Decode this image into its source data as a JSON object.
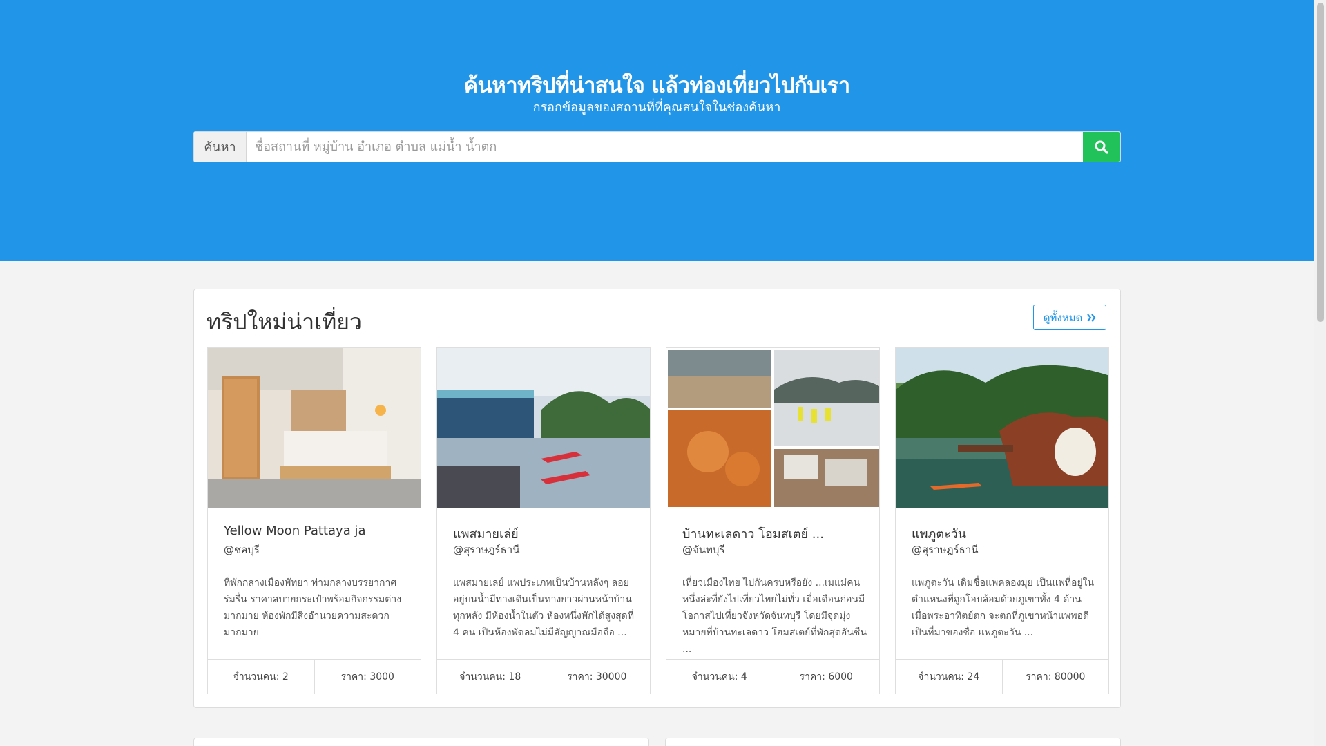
{
  "hero": {
    "title": "ค้นหาทริปที่น่าสนใจ แล้วท่องเที่ยวไปกับเรา",
    "subtitle": "กรอกข้อมูลของสถานที่ที่คุณสนใจในช่องค้นหา"
  },
  "search": {
    "addon_label": "ค้นหา",
    "placeholder": "ชื่อสถานที่ หมู่บ้าน อำเภอ ตำบล แม่น้ำ น้ำตก",
    "value": "",
    "button_icon": "search-icon"
  },
  "section": {
    "title": "ทริปใหม่น่าเที่ยว",
    "see_all_label": "ดูทั้งหมด",
    "see_all_icon": "double-chevron-right-icon"
  },
  "cards": [
    {
      "title": "Yellow Moon Pattaya ja",
      "location": "@ชลบุรี",
      "description": "ที่พักกลางเมืองพัทยา ท่ามกลางบรรยากาศร่มรื่น ราคาสบายกระเป๋าพร้อมกิจกรรมต่างมากมาย ห้องพักมีสิ่งอำนวยความสะดวกมากมาย",
      "people": "จำนวนคน: 2",
      "price": "ราคา: 3000"
    },
    {
      "title": "แพสมายเล่ย์",
      "location": "@สุราษฎร์ธานี",
      "description": "แพสมายเลย์ แพประเภทเป็นบ้านหลังๆ ลอยอยู่บนน้ำมีทางเดินเป็นทางยาวผ่านหน้าบ้านทุกหลัง มีห้องน้ำในตัว ห้องหนึ่งพักได้สูงสุดที่ 4 คน เป็นห้องพัดลมไม่มีสัญญาณมือถือ ...",
      "people": "จำนวนคน: 18",
      "price": "ราคา: 30000"
    },
    {
      "title": "บ้านทะเลดาว โฮมสเตย์ ...",
      "location": "@จันทบุรี",
      "description": "เที่ยวเมืองไทย ไปกันครบหรือยัง ...เมแม่คนหนึ่งล่ะที่ยังไปเที่ยวไทยไม่ทั่ว เมื่อเดือนก่อนมีโอกาสไปเที่ยวจังหวัดจันทบุรี โดยมีจุดมุ่งหมายที่บ้านทะเลดาว โฮมสเตย์ที่พักสุดอันชีน ...",
      "people": "จำนวนคน: 4",
      "price": "ราคา: 6000"
    },
    {
      "title": "แพภูตะวัน",
      "location": "@สุราษฎร์ธานี",
      "description": "แพภูตะวัน เดิมชื่อแพคลองมุย เป็นแพที่อยู่ในตำแหน่งที่ถูกโอบล้อมด้วยภูเขาทั้ง 4 ด้าน เมื่อพระอาทิตย์ตก จะตกที่ภูเขาหน้าแพพอดีเป็นที่มาของชื่อ แพภูตะวัน ...",
      "people": "จำนวนคน: 24",
      "price": "ราคา: 80000"
    }
  ],
  "colors": {
    "hero_bg": "#2196e8",
    "search_button": "#21c25a",
    "accent": "#2196e8"
  }
}
